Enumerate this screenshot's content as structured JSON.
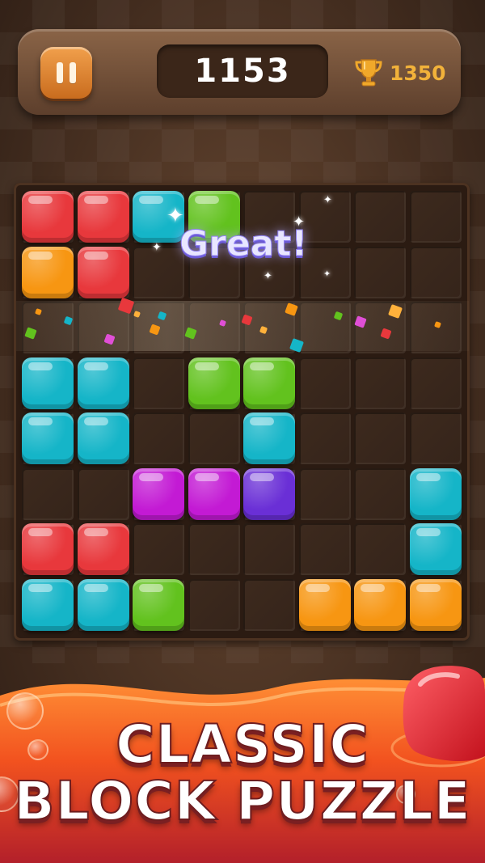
{
  "hud": {
    "score": "1153",
    "best_score": "1350",
    "best_icon": "trophy-icon",
    "pause_icon": "pause-icon"
  },
  "board": {
    "rows": 8,
    "cols": 8,
    "grid": [
      [
        "red",
        "red",
        "cyan",
        "green",
        "",
        "",
        "",
        ""
      ],
      [
        "orange",
        "red",
        "",
        "",
        "",
        "",
        "",
        ""
      ],
      [
        "",
        "",
        "",
        "",
        "",
        "",
        "",
        ""
      ],
      [
        "cyan",
        "cyan",
        "",
        "green",
        "green",
        "",
        "",
        ""
      ],
      [
        "cyan",
        "cyan",
        "",
        "",
        "cyan",
        "",
        "",
        ""
      ],
      [
        "",
        "",
        "magenta",
        "magenta",
        "purple",
        "",
        "",
        "cyan"
      ],
      [
        "red",
        "red",
        "",
        "",
        "",
        "",
        "",
        "cyan"
      ],
      [
        "cyan",
        "cyan",
        "green",
        "",
        "",
        "orange",
        "orange",
        "orange"
      ]
    ],
    "cleared_row": 2
  },
  "colors": {
    "red": "#e8383c",
    "cyan": "#15b5c8",
    "green": "#62c21e",
    "orange": "#f79612",
    "magenta": "#c31ad4",
    "purple": "#6a2fd6"
  },
  "combo": {
    "text": "Great!"
  },
  "banner": {
    "line1": "CLASSIC",
    "line2": "BLOCK PUZZLE"
  }
}
